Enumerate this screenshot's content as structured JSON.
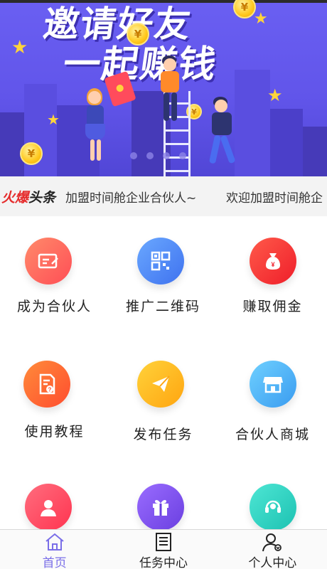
{
  "banner": {
    "title_line1": "邀请好友",
    "title_line2": "一起赚钱",
    "coin_symbol": "¥",
    "slide_count": 4
  },
  "ticker": {
    "logo_part1": "火爆",
    "logo_part2": "头条",
    "text1": "加盟时间舱企业合伙人~",
    "text2": "欢迎加盟时间舱企"
  },
  "menu": [
    {
      "label": "成为合伙人",
      "icon": "id-card-icon",
      "color": "#ff5f5f"
    },
    {
      "label": "推广二维码",
      "icon": "qr-code-icon",
      "color": "#4e8bf5"
    },
    {
      "label": "赚取佣金",
      "icon": "money-bag-icon",
      "color": "#ff3b3b"
    },
    {
      "label": "使用教程",
      "icon": "document-help-icon",
      "color": "#ff6a3a"
    },
    {
      "label": "发布任务",
      "icon": "paper-plane-icon",
      "color": "#ffb81f"
    },
    {
      "label": "合伙人商城",
      "icon": "shop-icon",
      "color": "#49b4f5"
    },
    {
      "label": "",
      "icon": "user-icon",
      "color": "#ff4d6a"
    },
    {
      "label": "",
      "icon": "gift-icon",
      "color": "#7a58ec"
    },
    {
      "label": "",
      "icon": "headset-icon",
      "color": "#2fd6c4"
    }
  ],
  "tabs": [
    {
      "label": "首页",
      "icon": "home-icon",
      "active": true
    },
    {
      "label": "任务中心",
      "icon": "list-icon",
      "active": false
    },
    {
      "label": "个人中心",
      "icon": "person-icon",
      "active": false
    }
  ],
  "colors": {
    "banner_bg": "#6155ea",
    "accent": "#7a6ee8",
    "ticker_bg": "#f3f3f3"
  }
}
